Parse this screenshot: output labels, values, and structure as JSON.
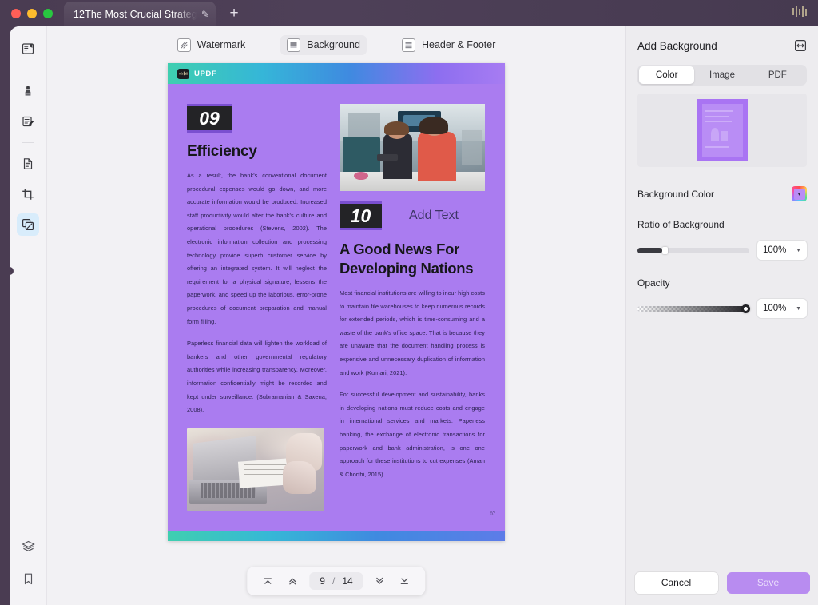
{
  "window": {
    "tab_title": "12The Most Crucial Strateg",
    "tab_edit_icon": "pencil-icon",
    "new_tab_icon": "plus-icon",
    "traffic_lights": [
      "close-red",
      "minimize-yellow",
      "zoom-green"
    ]
  },
  "rail": {
    "items": [
      {
        "name": "reader-view",
        "icon": "book-reader-icon",
        "selected": false
      },
      {
        "name": "annotate-marker",
        "icon": "highlighter-icon",
        "selected": false
      },
      {
        "name": "edit-pdf",
        "icon": "edit-document-icon",
        "selected": false
      },
      {
        "name": "ocr-convert",
        "icon": "document-scan-icon",
        "selected": false
      },
      {
        "name": "crop-page",
        "icon": "crop-icon",
        "selected": false
      },
      {
        "name": "organize-pages",
        "icon": "pages-stack-icon",
        "selected": true
      }
    ],
    "bottom_items": [
      {
        "name": "layers",
        "icon": "layers-icon"
      },
      {
        "name": "bookmarks",
        "icon": "bookmark-icon"
      }
    ]
  },
  "toolbar": {
    "items": [
      {
        "label": "Watermark",
        "icon": "watermark-icon",
        "active": false
      },
      {
        "label": "Background",
        "icon": "background-icon",
        "active": true
      },
      {
        "label": "Header & Footer",
        "icon": "header-footer-icon",
        "active": false
      }
    ]
  },
  "document": {
    "banner_brand": "UPDF",
    "badge_left": "09",
    "heading_left": "Efficiency",
    "paragraph_left_1": "As a result, the bank's conventional document procedural expenses would go down, and more accurate information would be produced. Increased staff productivity would alter the bank's culture and operational procedures (Stevens, 2002). The electronic information collection and processing technology provide superb customer service by offering an integrated system. It will neglect the requirement for a physical signature, lessens the paperwork, and speed up the laborious, error-prone procedures of document preparation and manual form filling.",
    "paragraph_left_2": "Paperless financial data will lighten the workload of bankers and other governmental regulatory authorities while increasing transparency. Moreover, information confidentially might be recorded and kept under surveillance. (Subramanian & Saxena, 2008).",
    "badge_right": "10",
    "add_text_label": "Add Text",
    "heading_right": "A Good News For Developing Nations",
    "paragraph_right_1": "Most financial institutions are willing to incur high costs to maintain file warehouses to keep numerous records for extended periods, which is time-consuming and a waste of the bank's office space. That is because they are unaware that the document handling process is expensive and unnecessary duplication of information and work (Kumari, 2021).",
    "paragraph_right_2": "For successful development and sustainability, banks in developing nations must reduce costs and engage in international services and markets. Paperless banking, the exchange of electronic transactions for paperwork and bank administration, is one one approach for these institutions to cut expenses (Aman & Chorthi, 2015).",
    "folio": "07",
    "image_office_alt": "two-women-at-desk-photo",
    "image_laptop_alt": "laptop-and-paperwork-photo"
  },
  "pagenav": {
    "first_icon": "first-page-icon",
    "prev_icon": "previous-page-icon",
    "current_page": "9",
    "separator": "/",
    "total_pages": "14",
    "next_icon": "next-page-icon",
    "last_icon": "last-page-icon"
  },
  "panel": {
    "title": "Add Background",
    "collapse_icon": "collapse-panel-icon",
    "tabs": [
      {
        "label": "Color",
        "selected": true
      },
      {
        "label": "Image",
        "selected": false
      },
      {
        "label": "PDF",
        "selected": false
      }
    ],
    "preview_alt": "background-preview-thumbnail",
    "background_color_label": "Background Color",
    "background_color_value": "#b98df5",
    "ratio_label": "Ratio of Background",
    "ratio_value": "100%",
    "opacity_label": "Opacity",
    "opacity_value": "100%",
    "cancel_label": "Cancel",
    "save_label": "Save"
  }
}
